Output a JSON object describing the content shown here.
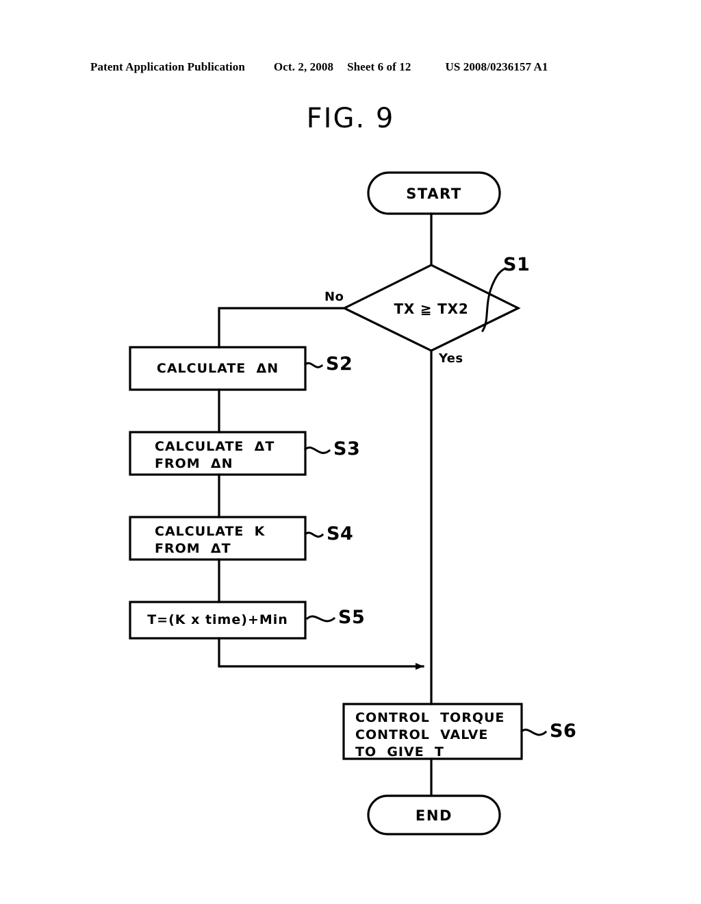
{
  "header": {
    "publication": "Patent Application Publication",
    "date": "Oct. 2, 2008",
    "sheet": "Sheet 6 of 12",
    "doc_number": "US 2008/0236157 A1"
  },
  "figure": {
    "title": "FIG. 9"
  },
  "flowchart": {
    "start_node": {
      "label": "START"
    },
    "end_node": {
      "label": "END"
    },
    "decision": {
      "label": "TX ≧ TX2",
      "step_ref": "S1",
      "no_label": "No",
      "yes_label": "Yes"
    },
    "steps": [
      {
        "step_ref": "S2",
        "line1": "CALCULATE  ΔN",
        "line2": ""
      },
      {
        "step_ref": "S3",
        "line1": "CALCULATE  ΔT",
        "line2": "FROM  ΔN"
      },
      {
        "step_ref": "S4",
        "line1": "CALCULATE  K",
        "line2": "FROM  ΔT"
      },
      {
        "step_ref": "S5",
        "line1": "T=(K x time)+Min",
        "line2": ""
      },
      {
        "step_ref": "S6",
        "line1": "CONTROL  TORQUE",
        "line2": "CONTROL  VALVE",
        "line3": "TO  GIVE  T"
      }
    ]
  },
  "colors": {
    "ink": "#000000",
    "paper": "#ffffff"
  }
}
